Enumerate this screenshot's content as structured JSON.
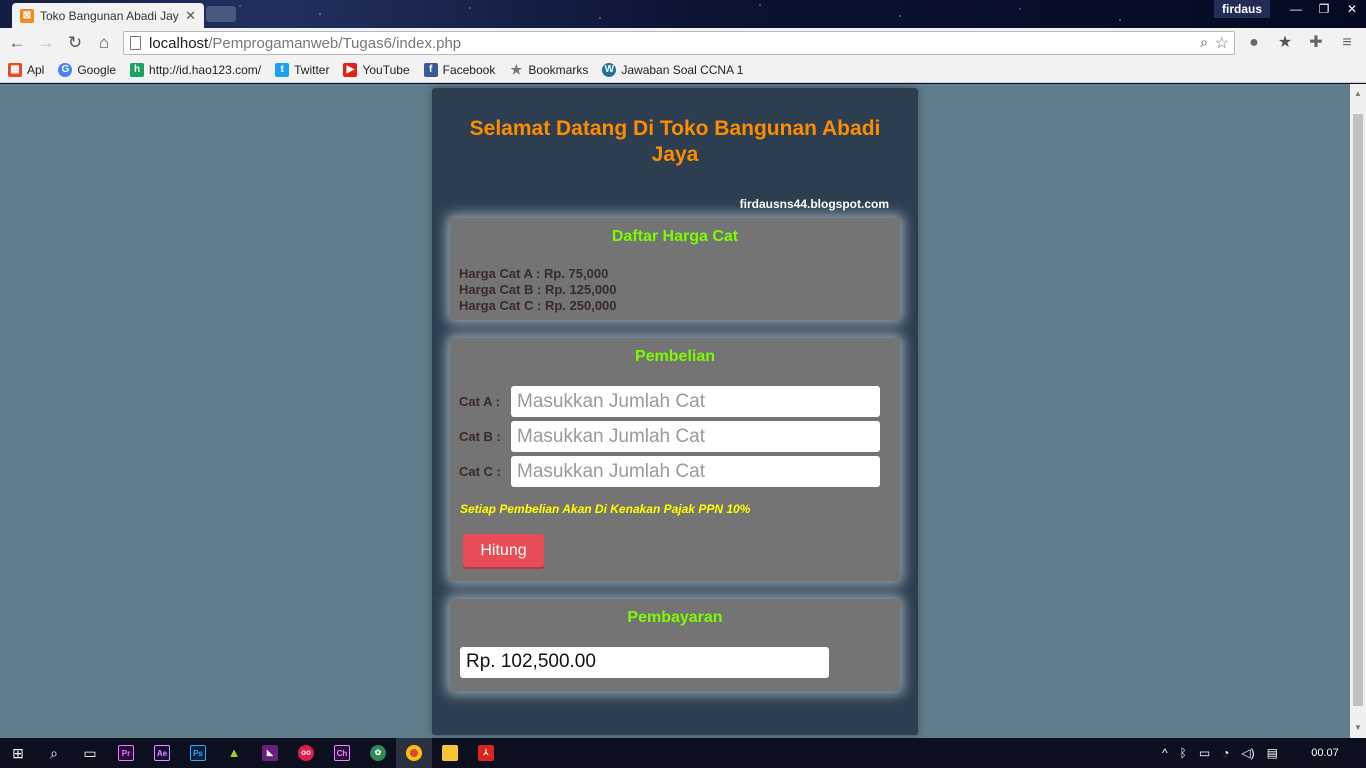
{
  "browser": {
    "tab_title": "Toko Bangunan Abadi Jay",
    "profile_name": "firdaus",
    "url_host": "localhost",
    "url_path": "/Pemprogamanweb/Tugas6/index.php"
  },
  "bookmarks": [
    {
      "label": "Apl",
      "icon": "apps-grid-icon",
      "color": "#e34c26"
    },
    {
      "label": "Google",
      "icon": "google-icon",
      "color": "#4285f4"
    },
    {
      "label": "http://id.hao123.com/",
      "icon": "hao123-icon",
      "color": "#1aa260"
    },
    {
      "label": "Twitter",
      "icon": "twitter-icon",
      "color": "#1da1f2"
    },
    {
      "label": "YouTube",
      "icon": "youtube-icon",
      "color": "#e62117"
    },
    {
      "label": "Facebook",
      "icon": "facebook-icon",
      "color": "#3b5998"
    },
    {
      "label": "Bookmarks",
      "icon": "star-icon",
      "color": "#777777"
    },
    {
      "label": "Jawaban Soal CCNA 1",
      "icon": "wordpress-icon",
      "color": "#21759b"
    }
  ],
  "page": {
    "title": "Selamat Datang Di Toko Bangunan Abadi Jaya",
    "site": "firdausns44.blogspot.com",
    "price_card": {
      "heading": "Daftar Harga Cat",
      "lines": [
        "Harga Cat A : Rp. 75,000",
        "Harga Cat B : Rp. 125,000",
        "Harga Cat C : Rp. 250,000"
      ]
    },
    "purchase_card": {
      "heading": "Pembelian",
      "fields": [
        {
          "label": "Cat A :",
          "placeholder": "Masukkan Jumlah Cat",
          "value": ""
        },
        {
          "label": "Cat B :",
          "placeholder": "Masukkan Jumlah Cat",
          "value": ""
        },
        {
          "label": "Cat C :",
          "placeholder": "Masukkan Jumlah Cat",
          "value": ""
        }
      ],
      "note": "Setiap Pembelian Akan Di Kenakan Pajak PPN 10%",
      "button": "Hitung"
    },
    "payment_card": {
      "heading": "Pembayaran",
      "total": "Rp. 102,500.00"
    }
  },
  "taskbar": {
    "clock": "00.07"
  },
  "colors": {
    "page_bg": "#607d8b",
    "panel_bg": "#2c3e50",
    "title": "#ff8c00",
    "card_heading": "#7cfc00",
    "note": "#ffff00",
    "button": "#e84c57"
  }
}
